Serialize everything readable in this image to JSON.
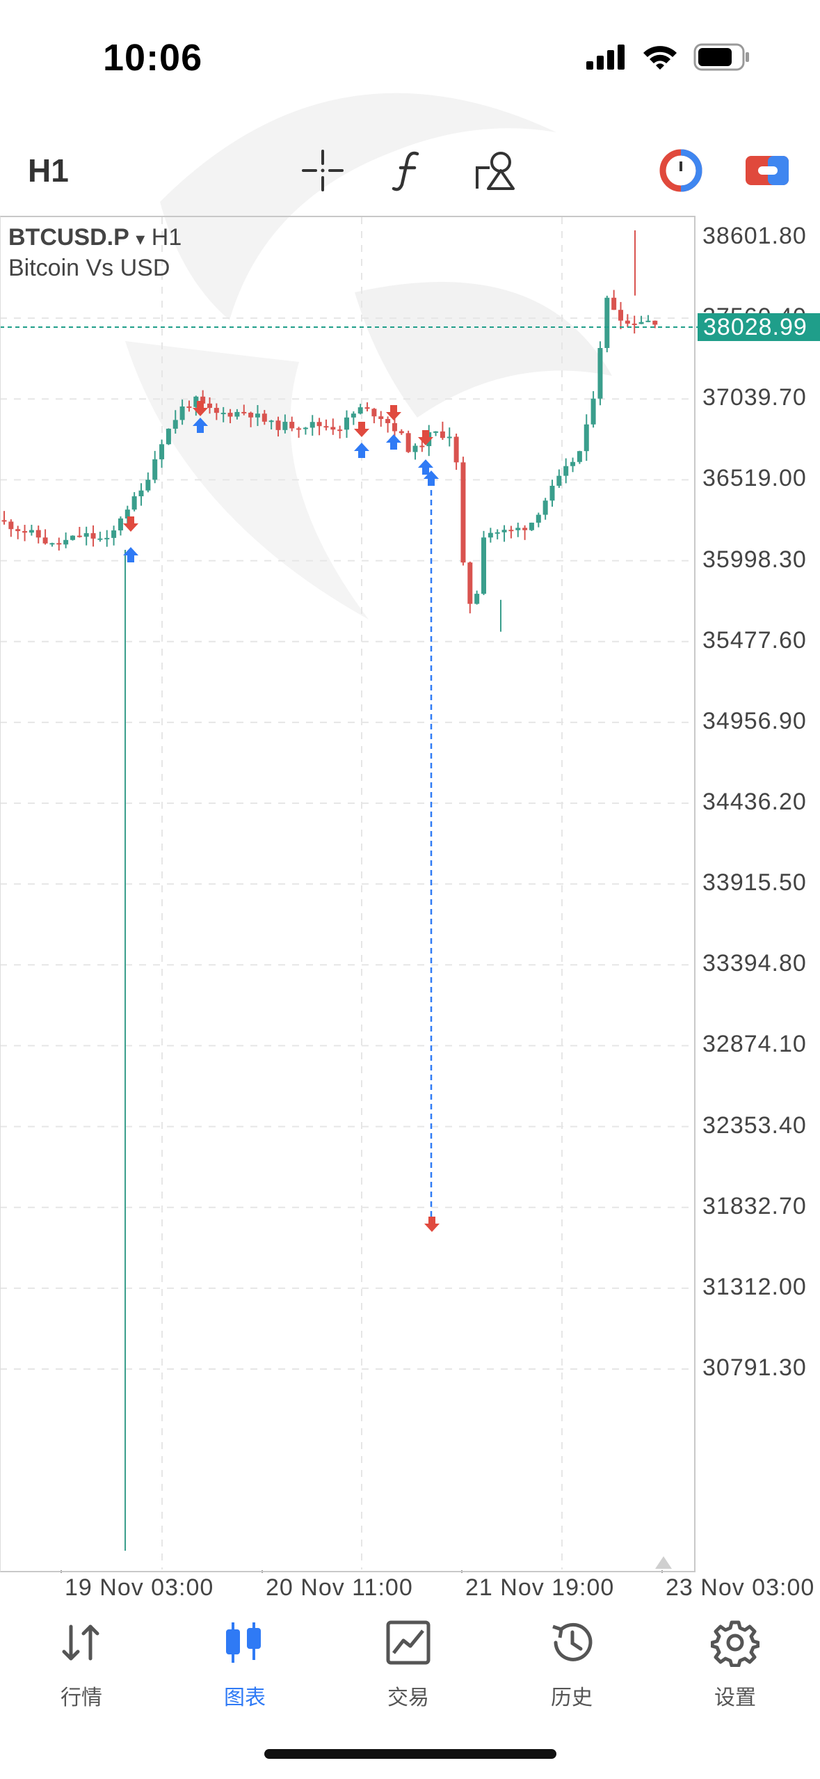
{
  "status_bar": {
    "time": "10:06"
  },
  "toolbar": {
    "timeframe": "H1",
    "icons": [
      "crosshair-icon",
      "function-icon",
      "objects-icon",
      "one-click-trading-icon",
      "trade-toggle-icon"
    ]
  },
  "chart": {
    "symbol": "BTCUSD.P",
    "dropdown_glyph": "▾",
    "timeframe": "H1",
    "description": "Bitcoin Vs USD",
    "current_price": "38028.99",
    "price_labels": [
      "38601.80",
      "37560.40",
      "37039.70",
      "36519.00",
      "35998.30",
      "35477.60",
      "34956.90",
      "34436.20",
      "33915.50",
      "33394.80",
      "32874.10",
      "32353.40",
      "31832.70",
      "31312.00",
      "30791.30"
    ],
    "time_labels": [
      "19 Nov 03:00",
      "20 Nov 11:00",
      "21 Nov 19:00",
      "23 Nov 03:00"
    ],
    "colors": {
      "bull": "#3a9e8c",
      "bear": "#d9534f",
      "buy_arrow": "#2f7af5",
      "sell_arrow": "#e04a3f",
      "price_line": "#1f9e8a"
    }
  },
  "chart_data": {
    "type": "candlestick",
    "symbol": "BTCUSD.P",
    "timeframe": "H1",
    "ylim": [
      30500,
      38750
    ],
    "last_price": 38028.99,
    "x_ticks": [
      "19 Nov 03:00",
      "20 Nov 11:00",
      "21 Nov 19:00",
      "23 Nov 03:00"
    ],
    "y_ticks": [
      38601.8,
      37560.4,
      37039.7,
      36519.0,
      35998.3,
      35477.6,
      34956.9,
      34436.2,
      33915.5,
      33394.8,
      32874.1,
      32353.4,
      31832.7,
      31312.0,
      30791.3
    ]
  },
  "tabs": [
    {
      "label": "行情",
      "icon": "quotes-arrows-icon",
      "active": false
    },
    {
      "label": "图表",
      "icon": "candlestick-chart-icon",
      "active": true
    },
    {
      "label": "交易",
      "icon": "trade-chart-icon",
      "active": false
    },
    {
      "label": "历史",
      "icon": "history-clock-icon",
      "active": false
    },
    {
      "label": "设置",
      "icon": "settings-gear-icon",
      "active": false
    }
  ]
}
